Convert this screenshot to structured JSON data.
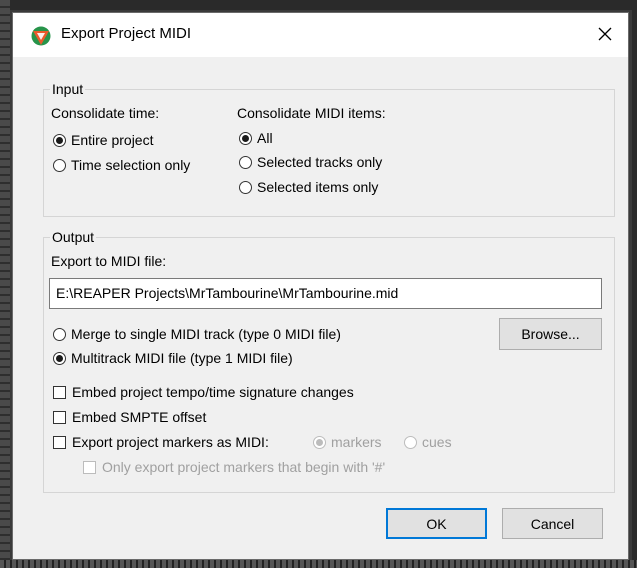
{
  "window": {
    "title": "Export Project MIDI"
  },
  "input_group": {
    "legend": "Input",
    "consolidate_time": {
      "label": "Consolidate time:",
      "options": [
        "Entire project",
        "Time selection only"
      ],
      "selected": "Entire project"
    },
    "consolidate_items": {
      "label": "Consolidate MIDI items:",
      "options": [
        "All",
        "Selected tracks only",
        "Selected items only"
      ],
      "selected": "All"
    }
  },
  "output_group": {
    "legend": "Output",
    "file_label": "Export to MIDI file:",
    "file_path": "E:\\REAPER Projects\\MrTambourine\\MrTambourine.mid",
    "browse_label": "Browse...",
    "format_options": [
      "Merge to single MIDI track (type 0 MIDI file)",
      "Multitrack MIDI file (type 1 MIDI file)"
    ],
    "format_selected": "Multitrack MIDI file (type 1 MIDI file)",
    "checkboxes": {
      "tempo": "Embed project tempo/time signature changes",
      "smpte": "Embed SMPTE offset",
      "markers": "Export project markers as MIDI:",
      "only_hash": "Only export project markers that begin with '#'"
    },
    "marker_type_options": [
      "markers",
      "cues"
    ],
    "marker_type_selected": "markers"
  },
  "buttons": {
    "ok": "OK",
    "cancel": "Cancel"
  },
  "colors": {
    "dialog_bg": "#f0f0f0",
    "titlebar_bg": "#ffffff",
    "default_button_border": "#0078d7"
  },
  "icons": {
    "app": "reaper-logo-icon",
    "close": "close-icon"
  }
}
